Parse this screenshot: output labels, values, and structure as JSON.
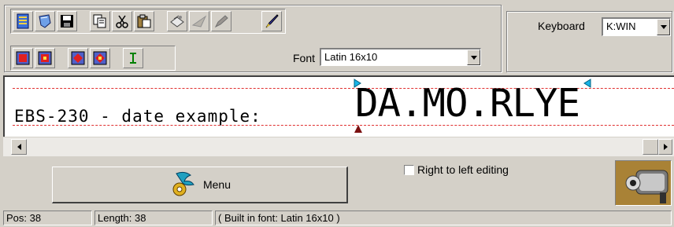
{
  "toolbar": {
    "row1_icons": [
      "new-document-icon",
      "open-icon",
      "save-icon",
      "copy-icon",
      "cut-icon",
      "paste-icon",
      "printer-icon",
      "send-icon",
      "pen-icon"
    ],
    "row2_icons": [
      "print-label-icon",
      "print-red-icon",
      "stop-icon",
      "stop-red-icon",
      "cursor-insert-icon"
    ],
    "font_label": "Font",
    "font_value": "Latin 16x10"
  },
  "keyboard": {
    "label": "Keyboard",
    "value": "K:WIN"
  },
  "editor": {
    "small_text": "EBS-230 - date example:",
    "large_text": "DA.MO.RLYE"
  },
  "menu": {
    "label": "Menu"
  },
  "rtl": {
    "label": "Right to left editing",
    "checked": false
  },
  "status": {
    "pos": "Pos: 38",
    "length": "Length: 38",
    "font": "( Built in font: Latin 16x10 )"
  },
  "colors": {
    "background": "#d4d0c8",
    "guide_red": "#e03030",
    "marker_cyan": "#19b4e6",
    "marker_dark_red": "#7a1010"
  }
}
